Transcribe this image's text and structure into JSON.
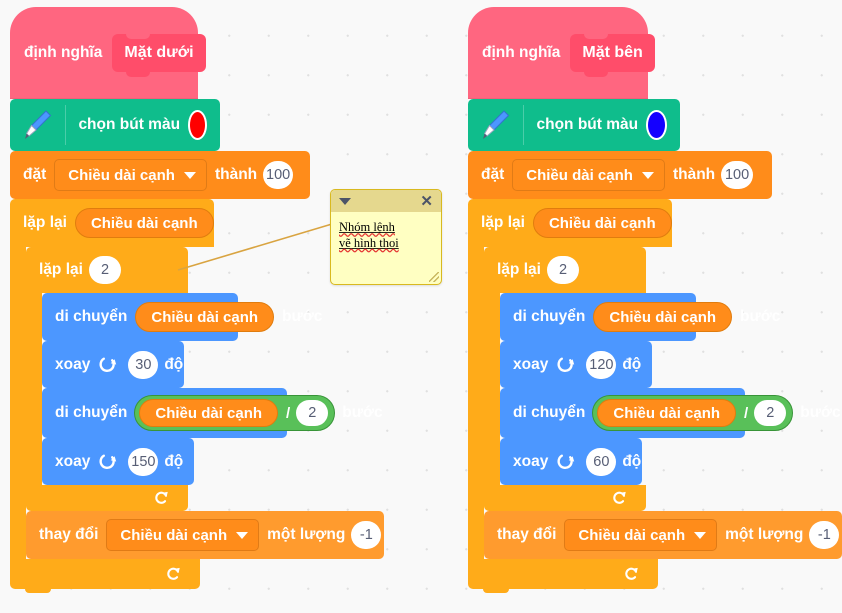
{
  "workspace": {
    "background_color": "#f9f9f9",
    "grid_dot_color": "#e0e0e0"
  },
  "palette": {
    "hat_color": "#FF6680",
    "hat_inner_color": "#FF4D6A",
    "pen_color": "#0FBD8C",
    "variables_color": "#FF8C1A",
    "motion_color": "#4C97FF",
    "control_color": "#FFAB19",
    "operators_color": "#59C059",
    "comment_color": "#FFFFC2"
  },
  "scripts": [
    {
      "id": "script-left",
      "define": {
        "keyword": "định nghĩa",
        "procedure_name": "Mặt dưới"
      },
      "pen": {
        "label": "chọn bút màu",
        "swatch_color": "#FF0000",
        "icon": "pen-icon"
      },
      "set_var": {
        "keyword": "đặt",
        "variable": "Chiều dài cạnh",
        "to_label": "thành",
        "value": "100"
      },
      "outer_repeat": {
        "keyword": "lặp lại",
        "times_variable": "Chiều dài cạnh"
      },
      "inner_repeat": {
        "keyword": "lặp lại",
        "times": "2"
      },
      "move1": {
        "keyword": "di chuyển",
        "variable": "Chiều dài cạnh",
        "steps_label": "bước"
      },
      "turn1": {
        "keyword": "xoay",
        "icon": "turn-clockwise-icon",
        "degrees": "30",
        "degrees_label": "độ"
      },
      "move2": {
        "keyword": "di chuyển",
        "variable": "Chiều dài cạnh",
        "operator": "/",
        "operand": "2",
        "steps_label": "bước"
      },
      "turn2": {
        "keyword": "xoay",
        "icon": "turn-clockwise-icon",
        "degrees": "150",
        "degrees_label": "độ"
      },
      "change_var": {
        "keyword": "thay đổi",
        "variable": "Chiều dài cạnh",
        "by_label": "một lượng",
        "value": "-1"
      }
    },
    {
      "id": "script-right",
      "define": {
        "keyword": "định nghĩa",
        "procedure_name": "Mặt bên"
      },
      "pen": {
        "label": "chọn bút màu",
        "swatch_color": "#1400FF",
        "icon": "pen-icon"
      },
      "set_var": {
        "keyword": "đặt",
        "variable": "Chiều dài cạnh",
        "to_label": "thành",
        "value": "100"
      },
      "outer_repeat": {
        "keyword": "lặp lại",
        "times_variable": "Chiều dài cạnh"
      },
      "inner_repeat": {
        "keyword": "lặp lại",
        "times": "2"
      },
      "move1": {
        "keyword": "di chuyển",
        "variable": "Chiều dài cạnh",
        "steps_label": "bước"
      },
      "turn1": {
        "keyword": "xoay",
        "icon": "turn-clockwise-icon",
        "degrees": "120",
        "degrees_label": "độ"
      },
      "move2": {
        "keyword": "di chuyển",
        "variable": "Chiều dài cạnh",
        "operator": "/",
        "operand": "2",
        "steps_label": "bước"
      },
      "turn2": {
        "keyword": "xoay",
        "icon": "turn-clockwise-icon",
        "degrees": "60",
        "degrees_label": "độ"
      },
      "change_var": {
        "keyword": "thay đổi",
        "variable": "Chiều dài cạnh",
        "by_label": "một lượng",
        "value": "-1"
      }
    }
  ],
  "comment": {
    "line1": "Nhóm lệnh",
    "line2": "vẽ hình thoi",
    "collapse_icon": "chevron-down-icon",
    "close_icon": "close-icon"
  }
}
